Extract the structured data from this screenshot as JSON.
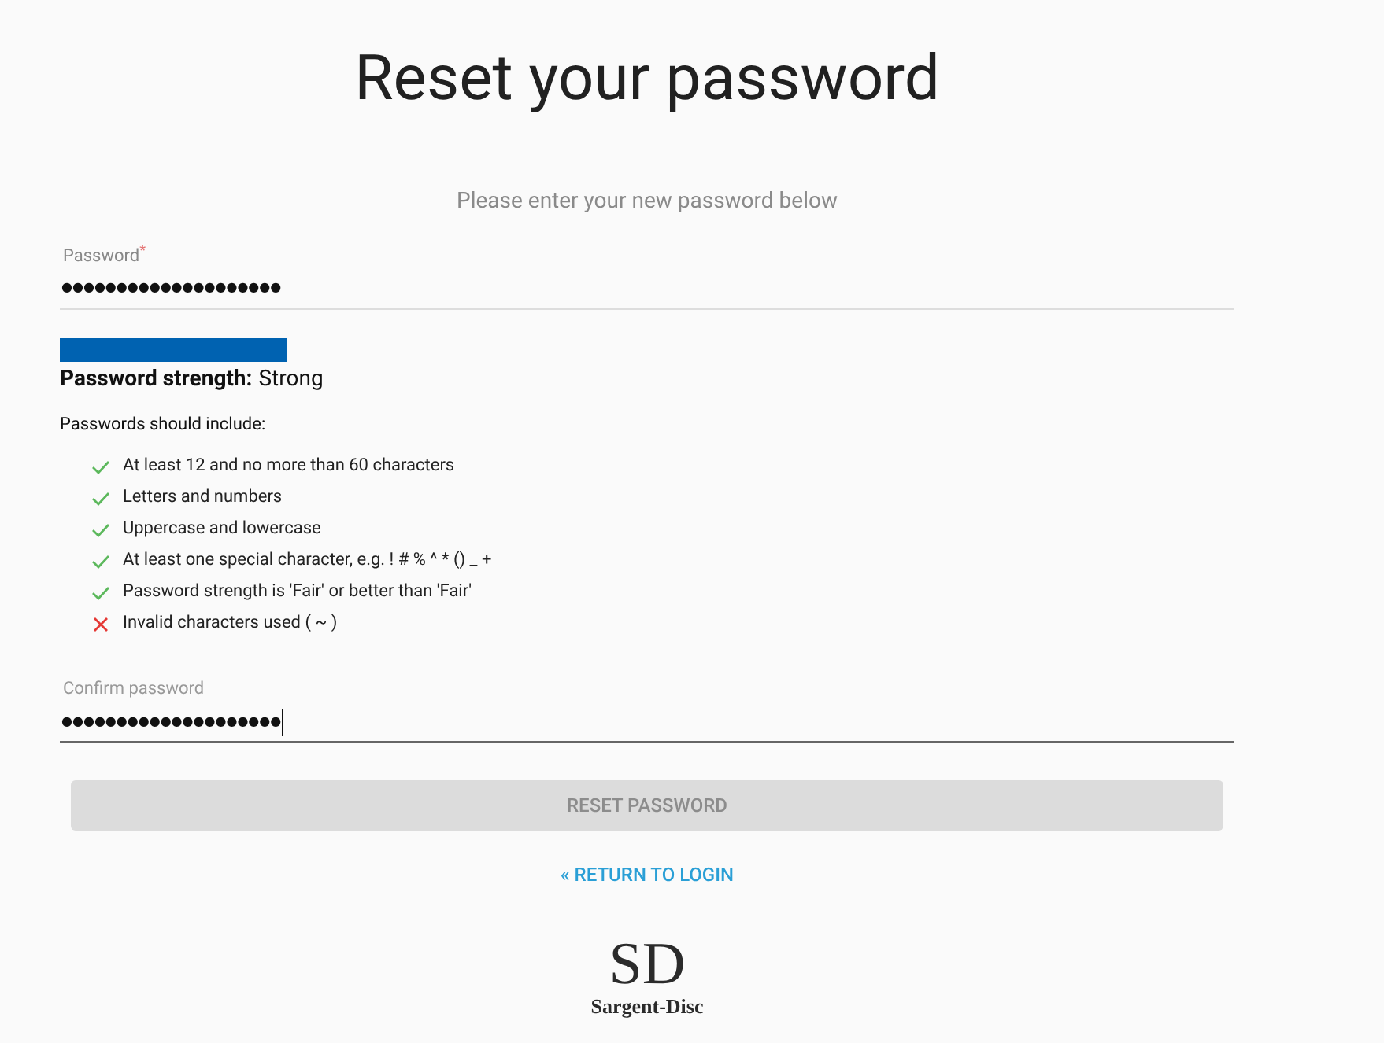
{
  "title": "Reset your password",
  "subtitle": "Please enter your new password below",
  "password": {
    "label": "Password",
    "required_mark": "*",
    "value": "●●●●●●●●●●●●●●●●●●●●",
    "focused": false
  },
  "strength": {
    "label": "Password strength:",
    "value": "Strong"
  },
  "rules_heading": "Passwords should include:",
  "rules": [
    {
      "text": "At least 12 and no more than 60 characters",
      "met": true
    },
    {
      "text": "Letters and numbers",
      "met": true
    },
    {
      "text": "Uppercase and lowercase",
      "met": true
    },
    {
      "text": "At least one special character, e.g. ! # % ^ * () _ +",
      "met": true
    },
    {
      "text": "Password strength is 'Fair' or better than 'Fair'",
      "met": true
    },
    {
      "text": "Invalid characters used ( ~ )",
      "met": false
    }
  ],
  "confirm": {
    "label": "Confirm password",
    "value": "●●●●●●●●●●●●●●●●●●●●",
    "focused": true
  },
  "reset_button": {
    "label": "RESET PASSWORD",
    "disabled": true
  },
  "return_link": "« RETURN TO LOGIN",
  "logo": {
    "monogram": "SD",
    "name": "Sargent-Disc"
  }
}
